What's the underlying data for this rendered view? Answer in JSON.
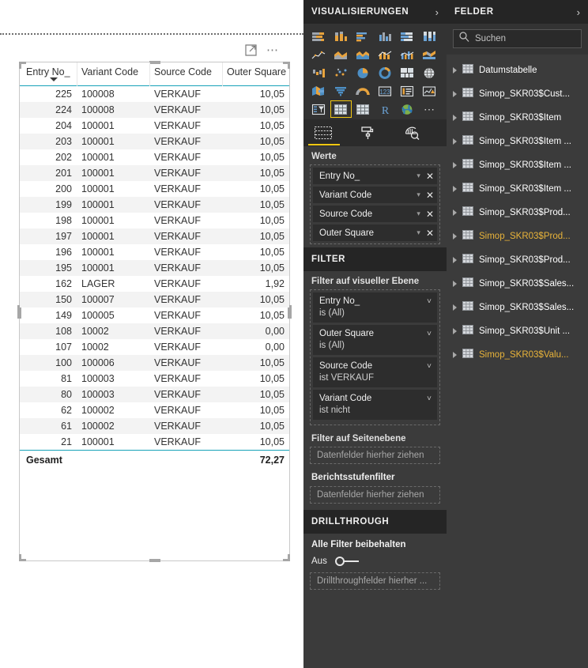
{
  "canvas": {
    "visual_toolbar": {
      "focus_mode_label": "Fokusmodus",
      "more_options_label": "..."
    },
    "table": {
      "columns": [
        "Entry No_",
        "Variant Code",
        "Source Code",
        "Outer Square"
      ],
      "sort_column": "Entry No_",
      "sort_direction": "descending",
      "rows": [
        [
          "225",
          "100008",
          "VERKAUF",
          "10,05"
        ],
        [
          "224",
          "100008",
          "VERKAUF",
          "10,05"
        ],
        [
          "204",
          "100001",
          "VERKAUF",
          "10,05"
        ],
        [
          "203",
          "100001",
          "VERKAUF",
          "10,05"
        ],
        [
          "202",
          "100001",
          "VERKAUF",
          "10,05"
        ],
        [
          "201",
          "100001",
          "VERKAUF",
          "10,05"
        ],
        [
          "200",
          "100001",
          "VERKAUF",
          "10,05"
        ],
        [
          "199",
          "100001",
          "VERKAUF",
          "10,05"
        ],
        [
          "198",
          "100001",
          "VERKAUF",
          "10,05"
        ],
        [
          "197",
          "100001",
          "VERKAUF",
          "10,05"
        ],
        [
          "196",
          "100001",
          "VERKAUF",
          "10,05"
        ],
        [
          "195",
          "100001",
          "VERKAUF",
          "10,05"
        ],
        [
          "162",
          "LAGER",
          "VERKAUF",
          "1,92"
        ],
        [
          "150",
          "100007",
          "VERKAUF",
          "10,05"
        ],
        [
          "149",
          "100005",
          "VERKAUF",
          "10,05"
        ],
        [
          "108",
          "10002",
          "VERKAUF",
          "0,00"
        ],
        [
          "107",
          "10002",
          "VERKAUF",
          "0,00"
        ],
        [
          "100",
          "100006",
          "VERKAUF",
          "10,05"
        ],
        [
          "81",
          "100003",
          "VERKAUF",
          "10,05"
        ],
        [
          "80",
          "100003",
          "VERKAUF",
          "10,05"
        ],
        [
          "62",
          "100002",
          "VERKAUF",
          "10,05"
        ],
        [
          "61",
          "100002",
          "VERKAUF",
          "10,05"
        ],
        [
          "21",
          "100001",
          "VERKAUF",
          "10,05"
        ]
      ],
      "total": {
        "label": "Gesamt",
        "value": "72,27"
      }
    }
  },
  "visualizations": {
    "header": {
      "title": "VISUALISIERUNGEN",
      "chevron": "›"
    },
    "gallery_icons": [
      "stacked-bar-chart-icon",
      "stacked-column-chart-icon",
      "clustered-bar-chart-icon",
      "clustered-column-chart-icon",
      "100-stacked-bar-chart-icon",
      "100-stacked-column-chart-icon",
      "line-chart-icon",
      "area-chart-icon",
      "stacked-area-chart-icon",
      "line-stacked-column-chart-icon",
      "line-clustered-column-chart-icon",
      "ribbon-chart-icon",
      "waterfall-chart-icon",
      "scatter-chart-icon",
      "pie-chart-icon",
      "donut-chart-icon",
      "treemap-icon",
      "map-icon",
      "filled-map-icon",
      "funnel-icon",
      "gauge-icon",
      "card-icon",
      "multi-row-card-icon",
      "kpi-icon",
      "slicer-icon",
      "table-icon",
      "matrix-icon",
      "r-script-visual-icon",
      "arcgis-map-icon",
      "more-visuals-icon"
    ],
    "selected_visual": "table-icon",
    "pane_tabs": [
      {
        "name": "fields-tab",
        "icon": "fields-grid-icon",
        "selected": true
      },
      {
        "name": "format-tab",
        "icon": "paint-roller-icon",
        "selected": false
      },
      {
        "name": "analytics-tab",
        "icon": "magnifier-chart-icon",
        "selected": false
      }
    ],
    "values_section": {
      "label": "Werte",
      "pills": [
        {
          "name": "Entry No_",
          "caret": "▾",
          "remove": "✕"
        },
        {
          "name": "Variant Code",
          "caret": "▾",
          "remove": "✕"
        },
        {
          "name": "Source Code",
          "caret": "▾",
          "remove": "✕"
        },
        {
          "name": "Outer Square",
          "caret": "▾",
          "remove": "✕"
        }
      ]
    },
    "filter_section": {
      "header": "FILTER",
      "visual_level_label": "Filter auf visueller Ebene",
      "visual_filters": [
        {
          "field": "Entry No_",
          "value": "is (All)"
        },
        {
          "field": "Outer Square",
          "value": "is (All)"
        },
        {
          "field": "Source Code",
          "value": "ist VERKAUF"
        },
        {
          "field": "Variant Code",
          "value": "ist nicht"
        }
      ],
      "page_level_label": "Filter auf Seitenebene",
      "page_level_dropzone": "Datenfelder hierher ziehen",
      "report_level_label": "Berichtsstufenfilter",
      "report_level_dropzone": "Datenfelder hierher ziehen"
    },
    "drillthrough_section": {
      "header": "DRILLTHROUGH",
      "keep_filters_label": "Alle Filter beibehalten",
      "toggle_state": "Aus",
      "dropzone": "Drillthroughfelder hierher ..."
    }
  },
  "fields": {
    "header": {
      "title": "FELDER",
      "chevron": "›"
    },
    "search": {
      "placeholder": "Suchen",
      "value": "",
      "icon": "search-icon"
    },
    "tables": [
      {
        "label": "Datumstabelle",
        "highlighted": false
      },
      {
        "label": "Simop_SKR03$Cust...",
        "highlighted": false
      },
      {
        "label": "Simop_SKR03$Item",
        "highlighted": false
      },
      {
        "label": "Simop_SKR03$Item ...",
        "highlighted": false
      },
      {
        "label": "Simop_SKR03$Item ...",
        "highlighted": false
      },
      {
        "label": "Simop_SKR03$Item ...",
        "highlighted": false
      },
      {
        "label": "Simop_SKR03$Prod...",
        "highlighted": false
      },
      {
        "label": "Simop_SKR03$Prod...",
        "highlighted": true
      },
      {
        "label": "Simop_SKR03$Prod...",
        "highlighted": false
      },
      {
        "label": "Simop_SKR03$Sales...",
        "highlighted": false
      },
      {
        "label": "Simop_SKR03$Sales...",
        "highlighted": false
      },
      {
        "label": "Simop_SKR03$Unit ...",
        "highlighted": false
      },
      {
        "label": "Simop_SKR03$Valu...",
        "highlighted": true
      }
    ]
  },
  "colors": {
    "accent_teal": "#17a2b8",
    "pbi_yellow": "#f2c811",
    "pane_bg": "#3b3b3b",
    "pane_header_bg": "#252525",
    "pill_bg": "#2d2d2d",
    "highlight_text": "#e8b33a"
  }
}
